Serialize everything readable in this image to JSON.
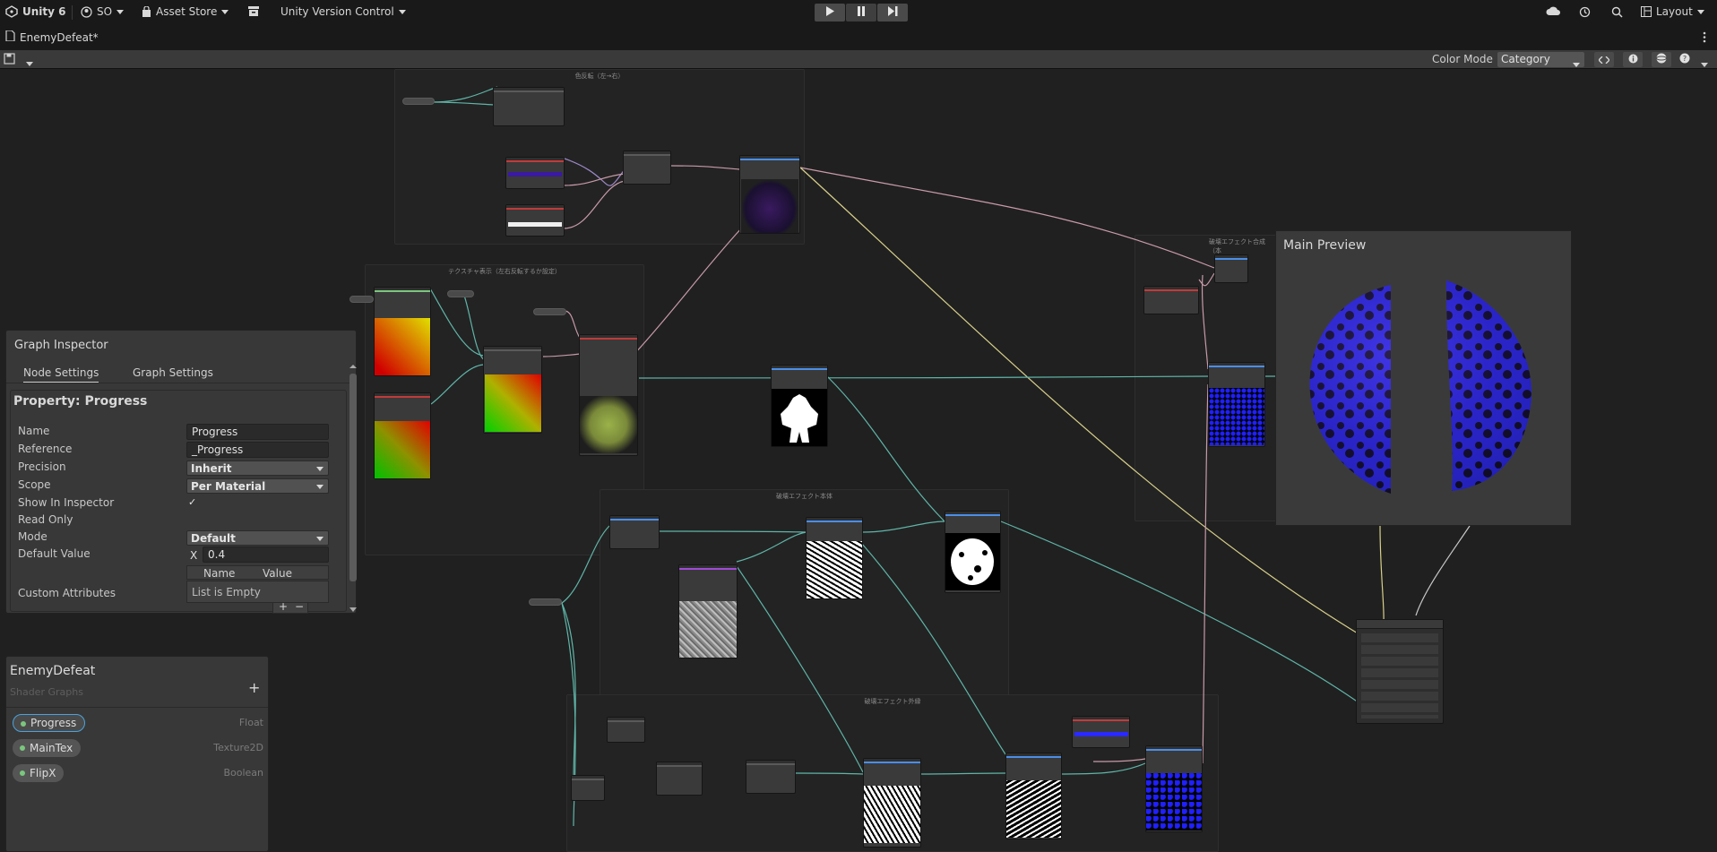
{
  "topbar": {
    "app_title": "Unity 6",
    "account_label": "SO",
    "asset_store_label": "Asset Store",
    "version_control_label": "Unity Version Control",
    "layout_label": "Layout"
  },
  "tab": {
    "title": "EnemyDefeat*"
  },
  "toolbar": {
    "color_mode_label": "Color Mode",
    "color_mode_value": "Category"
  },
  "graph": {
    "groups": [
      "色反転（左→右）",
      "テクスチャ表示（左右反転するか設定）",
      "破壊エフェクト本体",
      "破壊エフェクト外縁",
      "破壊エフェクト合成（本"
    ]
  },
  "inspector": {
    "title": "Graph Inspector",
    "tabs": [
      "Node Settings",
      "Graph Settings"
    ],
    "property_title": "Property: Progress",
    "name_label": "Name",
    "name_value": "Progress",
    "reference_label": "Reference",
    "reference_value": "_Progress",
    "precision_label": "Precision",
    "precision_value": "Inherit",
    "scope_label": "Scope",
    "scope_value": "Per Material",
    "show_in_inspector_label": "Show In Inspector",
    "show_in_inspector_checked": "✓",
    "read_only_label": "Read Only",
    "mode_label": "Mode",
    "mode_value": "Default",
    "default_value_label": "Default Value",
    "default_value_axis": "X",
    "default_value": "0.4",
    "custom_attributes_label": "Custom Attributes",
    "attr_col_name": "Name",
    "attr_col_value": "Value",
    "attr_empty": "List is Empty",
    "attr_add": "+",
    "attr_remove": "−"
  },
  "blackboard": {
    "title": "EnemyDefeat",
    "subtitle": "Shader Graphs",
    "add": "+",
    "properties": [
      {
        "name": "Progress",
        "type": "Float"
      },
      {
        "name": "MainTex",
        "type": "Texture2D"
      },
      {
        "name": "FlipX",
        "type": "Boolean"
      }
    ]
  },
  "main_preview": {
    "title": "Main Preview"
  },
  "colors": {
    "accent_blue": "#4aa3dd",
    "property_dot": "#7bc67e",
    "edge_teal": "#5fb5a8",
    "edge_pink": "#c89aa8",
    "edge_yellow": "#d8d08a",
    "effect_blue": "#2a2aff"
  }
}
